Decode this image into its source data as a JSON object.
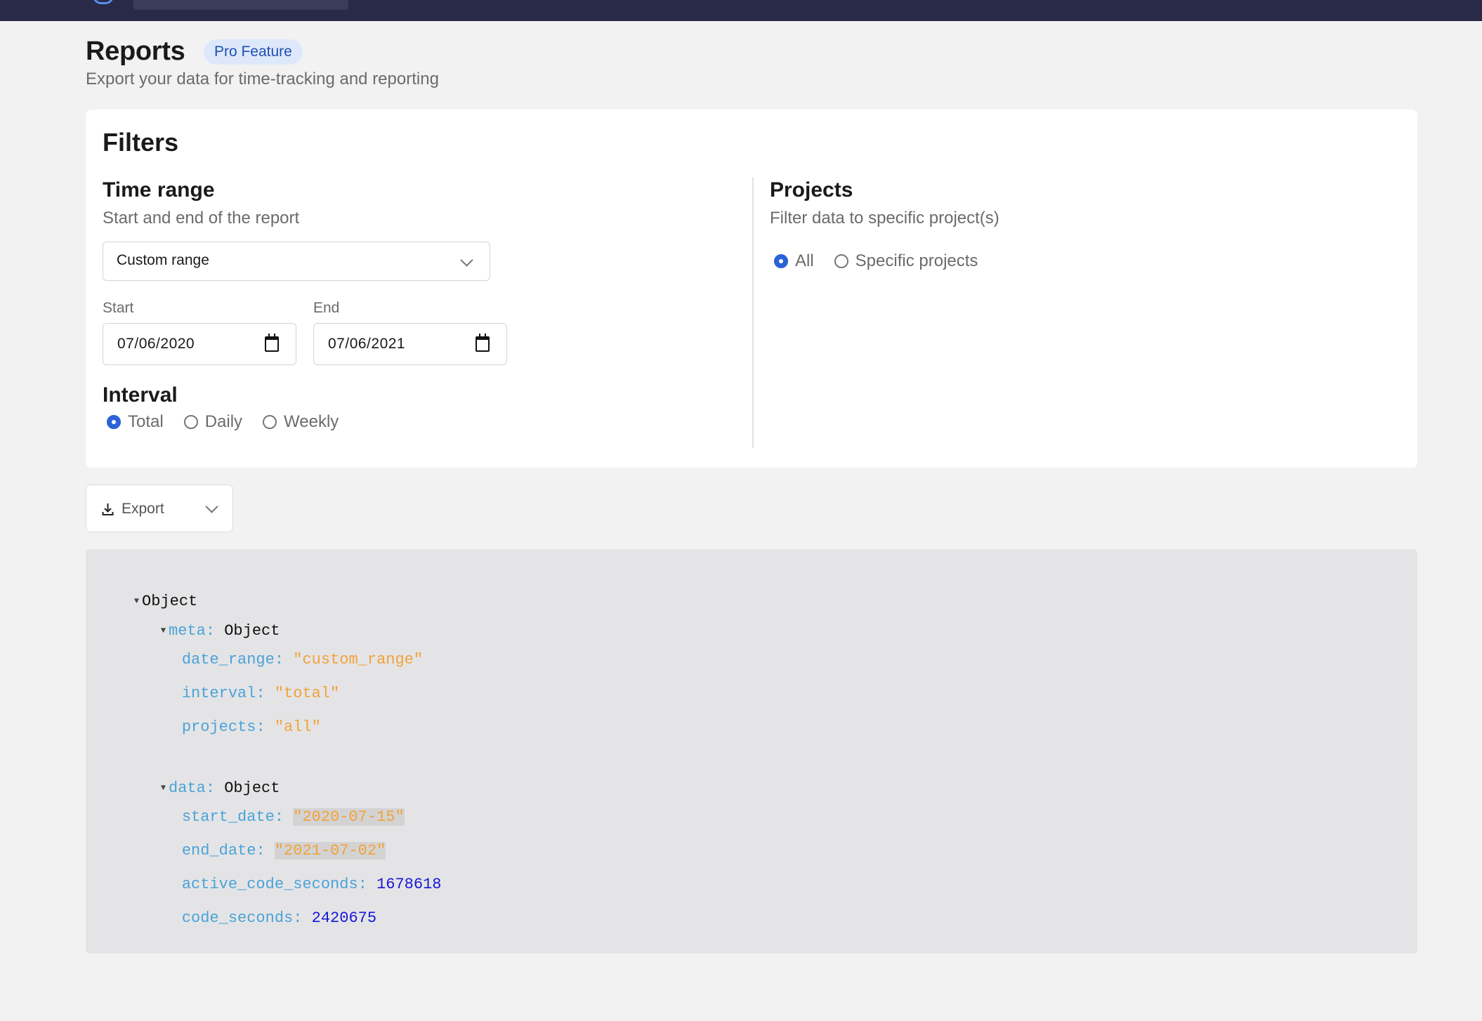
{
  "header": {
    "title": "Reports",
    "badge": "Pro Feature",
    "subtitle": "Export your data for time-tracking and reporting"
  },
  "filters": {
    "title": "Filters",
    "time_range": {
      "title": "Time range",
      "subtitle": "Start and end of the report",
      "selected": "Custom range",
      "start_label": "Start",
      "start_value": "07/06/2020",
      "end_label": "End",
      "end_value": "07/06/2021"
    },
    "interval": {
      "title": "Interval",
      "options": [
        "Total",
        "Daily",
        "Weekly"
      ],
      "selected": "Total"
    },
    "projects": {
      "title": "Projects",
      "subtitle": "Filter data to specific project(s)",
      "options": [
        "All",
        "Specific projects"
      ],
      "selected": "All"
    }
  },
  "export": {
    "label": "Export"
  },
  "json_view": {
    "root": "Object",
    "meta_key": "meta",
    "meta_type": "Object",
    "meta": {
      "date_range": {
        "key": "date_range",
        "value": "\"custom_range\""
      },
      "interval": {
        "key": "interval",
        "value": "\"total\""
      },
      "projects": {
        "key": "projects",
        "value": "\"all\""
      }
    },
    "data_key": "data",
    "data_type": "Object",
    "data": {
      "start_date": {
        "key": "start_date",
        "value": "\"2020-07-15\""
      },
      "end_date": {
        "key": "end_date",
        "value": "\"2021-07-02\""
      },
      "active_code_seconds": {
        "key": "active_code_seconds",
        "value": "1678618"
      },
      "code_seconds": {
        "key": "code_seconds",
        "value": "2420675"
      }
    }
  }
}
